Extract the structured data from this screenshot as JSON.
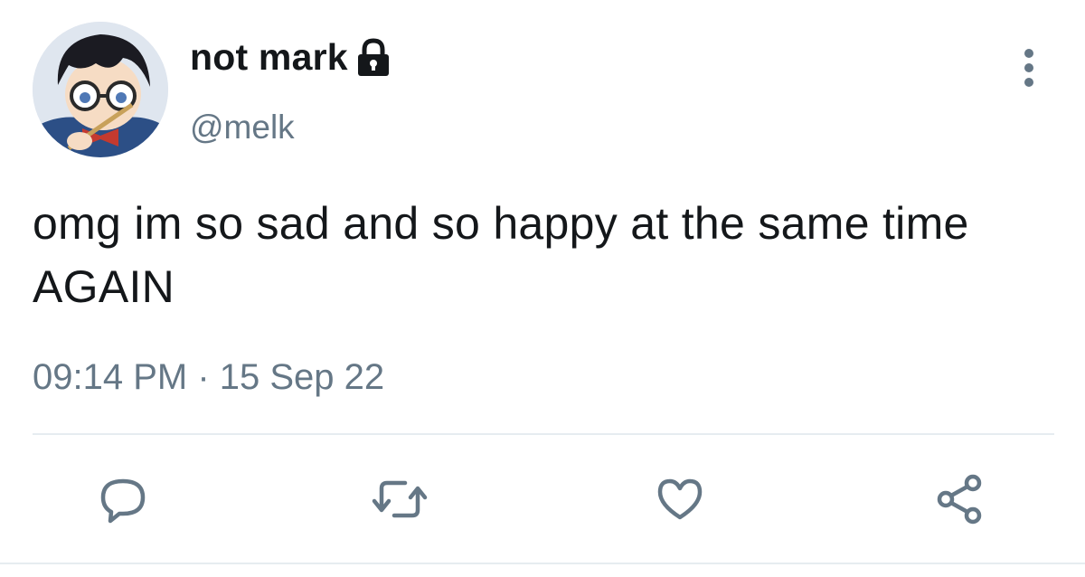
{
  "tweet": {
    "display_name": "not mark",
    "protected": true,
    "handle": "@melk",
    "text": "omg im so sad and so happy at the same time AGAIN",
    "timestamp": "09:14 PM · 15 Sep 22"
  },
  "icons": {
    "lock": "lock-icon",
    "more": "more-vertical-icon",
    "reply": "reply-icon",
    "retweet": "retweet-icon",
    "like": "heart-icon",
    "share": "share-icon"
  },
  "colors": {
    "text_primary": "#14171a",
    "text_secondary": "#657786",
    "icon": "#657786",
    "divider": "#e6ecf0"
  }
}
